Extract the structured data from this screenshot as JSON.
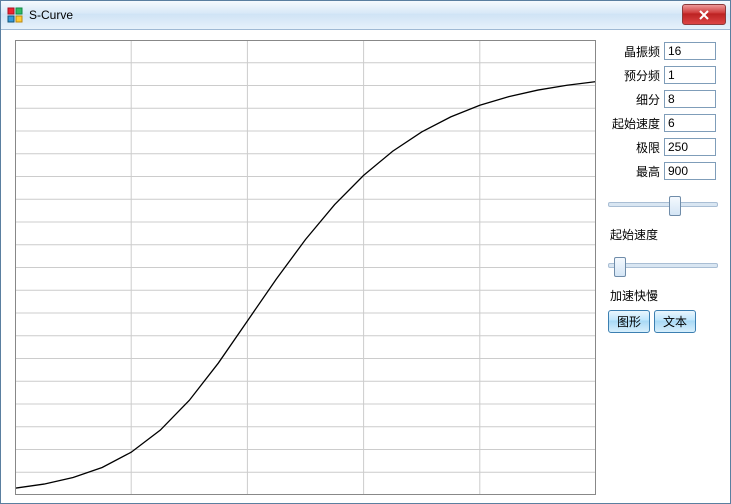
{
  "window": {
    "title": "S-Curve"
  },
  "params": {
    "crystal_freq": {
      "label": "晶振频",
      "value": "16"
    },
    "prescaler": {
      "label": "预分频",
      "value": "1"
    },
    "subdivision": {
      "label": "细分",
      "value": "8"
    },
    "start_speed": {
      "label": "起始速度",
      "value": "6"
    },
    "limit": {
      "label": "极限",
      "value": "250"
    },
    "max": {
      "label": "最高",
      "value": "900"
    }
  },
  "sections": {
    "start_speed2": "起始速度",
    "accel": "加速快慢"
  },
  "buttons": {
    "graph": "图形",
    "text": "文本"
  },
  "sliders": {
    "slider1_pos": 0.62,
    "slider2_pos": 0.06
  },
  "chart_data": {
    "type": "line",
    "title": "",
    "xlabel": "",
    "ylabel": "",
    "xlim": [
      0,
      5
    ],
    "ylim": [
      0,
      20
    ],
    "grid_x": 5,
    "grid_y": 20,
    "series": [
      {
        "name": "s-curve",
        "x": [
          0.0,
          0.25,
          0.5,
          0.75,
          1.0,
          1.25,
          1.5,
          1.75,
          2.0,
          2.25,
          2.5,
          2.75,
          3.0,
          3.25,
          3.5,
          3.75,
          4.0,
          4.25,
          4.5,
          4.75,
          5.0
        ],
        "y": [
          0.3,
          0.48,
          0.77,
          1.21,
          1.88,
          2.85,
          4.16,
          5.8,
          7.65,
          9.5,
          11.23,
          12.76,
          14.05,
          15.11,
          15.96,
          16.62,
          17.13,
          17.51,
          17.8,
          18.01,
          18.17
        ]
      }
    ]
  }
}
